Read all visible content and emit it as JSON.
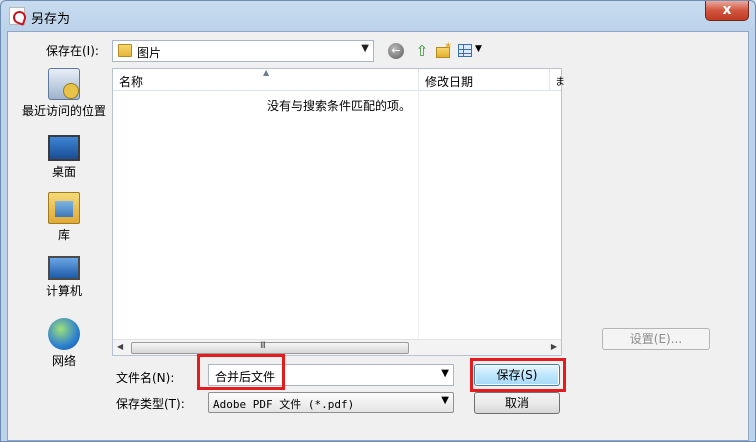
{
  "window": {
    "title": "另存为",
    "close_glyph": "x"
  },
  "save_in": {
    "label": "保存在(I):",
    "value": "图片"
  },
  "toolbar": {
    "back_glyph": "←",
    "up_glyph": "⇧",
    "newfolder_glyph": "✶",
    "view_arrow": "▼"
  },
  "places": [
    {
      "label": "最近访问的位置",
      "icon": "recent-places-icon"
    },
    {
      "label": "桌面",
      "icon": "desktop-icon"
    },
    {
      "label": "库",
      "icon": "libraries-icon"
    },
    {
      "label": "计算机",
      "icon": "computer-icon"
    },
    {
      "label": "网络",
      "icon": "network-icon"
    }
  ],
  "file_list": {
    "columns": [
      "名称",
      "修改日期",
      "ま"
    ],
    "empty_message": "没有与搜索条件匹配的项。",
    "scroll_grip": "III"
  },
  "settings_button": "设置(E)...",
  "file_name": {
    "label": "文件名(N):",
    "value": "合并后文件"
  },
  "file_type": {
    "label": "保存类型(T):",
    "value": "Adobe PDF 文件 (*.pdf)"
  },
  "buttons": {
    "save": "保存(S)",
    "cancel": "取消"
  },
  "colors": {
    "highlight": "#e31d1d",
    "title_bar": "#bcd3ea",
    "close_button": "#c13b22"
  }
}
